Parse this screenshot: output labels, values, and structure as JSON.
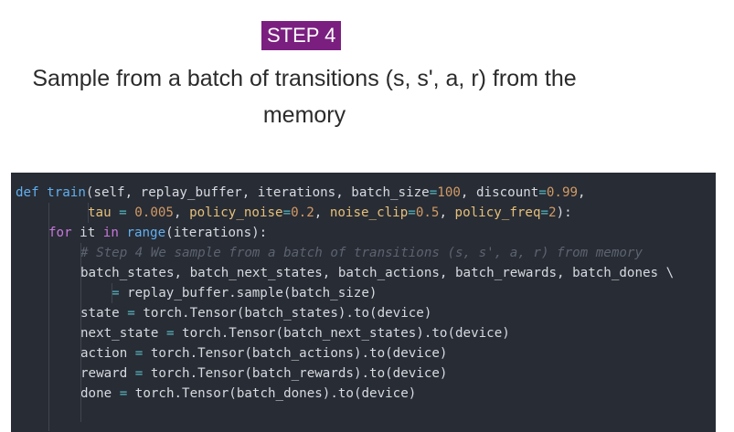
{
  "header": {
    "step_label": "STEP 4",
    "subtitle_line1": "Sample from a batch of transitions (s, s', a, r) from the",
    "subtitle_line2": "memory"
  },
  "code": {
    "lines": [
      {
        "indent": 0,
        "tokens": [
          {
            "t": "def",
            "c": "kw2"
          },
          {
            "t": " ",
            "c": "plain"
          },
          {
            "t": "train",
            "c": "fn"
          },
          {
            "t": "(self, replay_buffer, iterations, batch_size",
            "c": "plain"
          },
          {
            "t": "=",
            "c": "op"
          },
          {
            "t": "100",
            "c": "num"
          },
          {
            "t": ", discount",
            "c": "plain"
          },
          {
            "t": "=",
            "c": "op"
          },
          {
            "t": "0.99",
            "c": "num"
          },
          {
            "t": ",",
            "c": "plain"
          }
        ]
      },
      {
        "indent": 1,
        "tokens": [
          {
            "t": "tau ",
            "c": "param"
          },
          {
            "t": "=",
            "c": "op"
          },
          {
            "t": " ",
            "c": "plain"
          },
          {
            "t": "0.005",
            "c": "num"
          },
          {
            "t": ", ",
            "c": "plain"
          },
          {
            "t": "policy_noise",
            "c": "param"
          },
          {
            "t": "=",
            "c": "op"
          },
          {
            "t": "0.2",
            "c": "num"
          },
          {
            "t": ", ",
            "c": "plain"
          },
          {
            "t": "noise_clip",
            "c": "param"
          },
          {
            "t": "=",
            "c": "op"
          },
          {
            "t": "0.5",
            "c": "num"
          },
          {
            "t": ", ",
            "c": "plain"
          },
          {
            "t": "policy_freq",
            "c": "param"
          },
          {
            "t": "=",
            "c": "op"
          },
          {
            "t": "2",
            "c": "num"
          },
          {
            "t": "):",
            "c": "plain"
          }
        ]
      },
      {
        "indent": 2,
        "tokens": [
          {
            "t": "for",
            "c": "kw"
          },
          {
            "t": " it ",
            "c": "plain"
          },
          {
            "t": "in",
            "c": "kw"
          },
          {
            "t": " ",
            "c": "plain"
          },
          {
            "t": "range",
            "c": "fn"
          },
          {
            "t": "(iterations):",
            "c": "plain"
          }
        ]
      },
      {
        "indent": 3,
        "tokens": [
          {
            "t": "# Step 4 We sample from a batch of transitions (s, s', a, r) from memory",
            "c": "cm"
          }
        ]
      },
      {
        "indent": 3,
        "tokens": [
          {
            "t": "batch_states, batch_next_states, batch_actions, batch_rewards, batch_dones \\",
            "c": "plain"
          }
        ]
      },
      {
        "indent": 4,
        "tokens": [
          {
            "t": "=",
            "c": "op"
          },
          {
            "t": " replay_buffer.sample(batch_size)",
            "c": "plain"
          }
        ]
      },
      {
        "indent": 3,
        "tokens": [
          {
            "t": "state ",
            "c": "plain"
          },
          {
            "t": "=",
            "c": "op"
          },
          {
            "t": " torch.Tensor(batch_states).to(device)",
            "c": "plain"
          }
        ]
      },
      {
        "indent": 3,
        "tokens": [
          {
            "t": "next_state ",
            "c": "plain"
          },
          {
            "t": "=",
            "c": "op"
          },
          {
            "t": " torch.Tensor(batch_next_states).to(device)",
            "c": "plain"
          }
        ]
      },
      {
        "indent": 3,
        "tokens": [
          {
            "t": "action ",
            "c": "plain"
          },
          {
            "t": "=",
            "c": "op"
          },
          {
            "t": " torch.Tensor(batch_actions).to(device)",
            "c": "plain"
          }
        ]
      },
      {
        "indent": 3,
        "tokens": [
          {
            "t": "reward ",
            "c": "plain"
          },
          {
            "t": "=",
            "c": "op"
          },
          {
            "t": " torch.Tensor(batch_rewards).to(device)",
            "c": "plain"
          }
        ]
      },
      {
        "indent": 3,
        "tokens": [
          {
            "t": "done ",
            "c": "plain"
          },
          {
            "t": "=",
            "c": "op"
          },
          {
            "t": " torch.Tensor(batch_dones).to(device)",
            "c": "plain"
          }
        ]
      }
    ]
  },
  "colors": {
    "step_badge": "#7a1f7f",
    "code_background": "#282c34"
  }
}
